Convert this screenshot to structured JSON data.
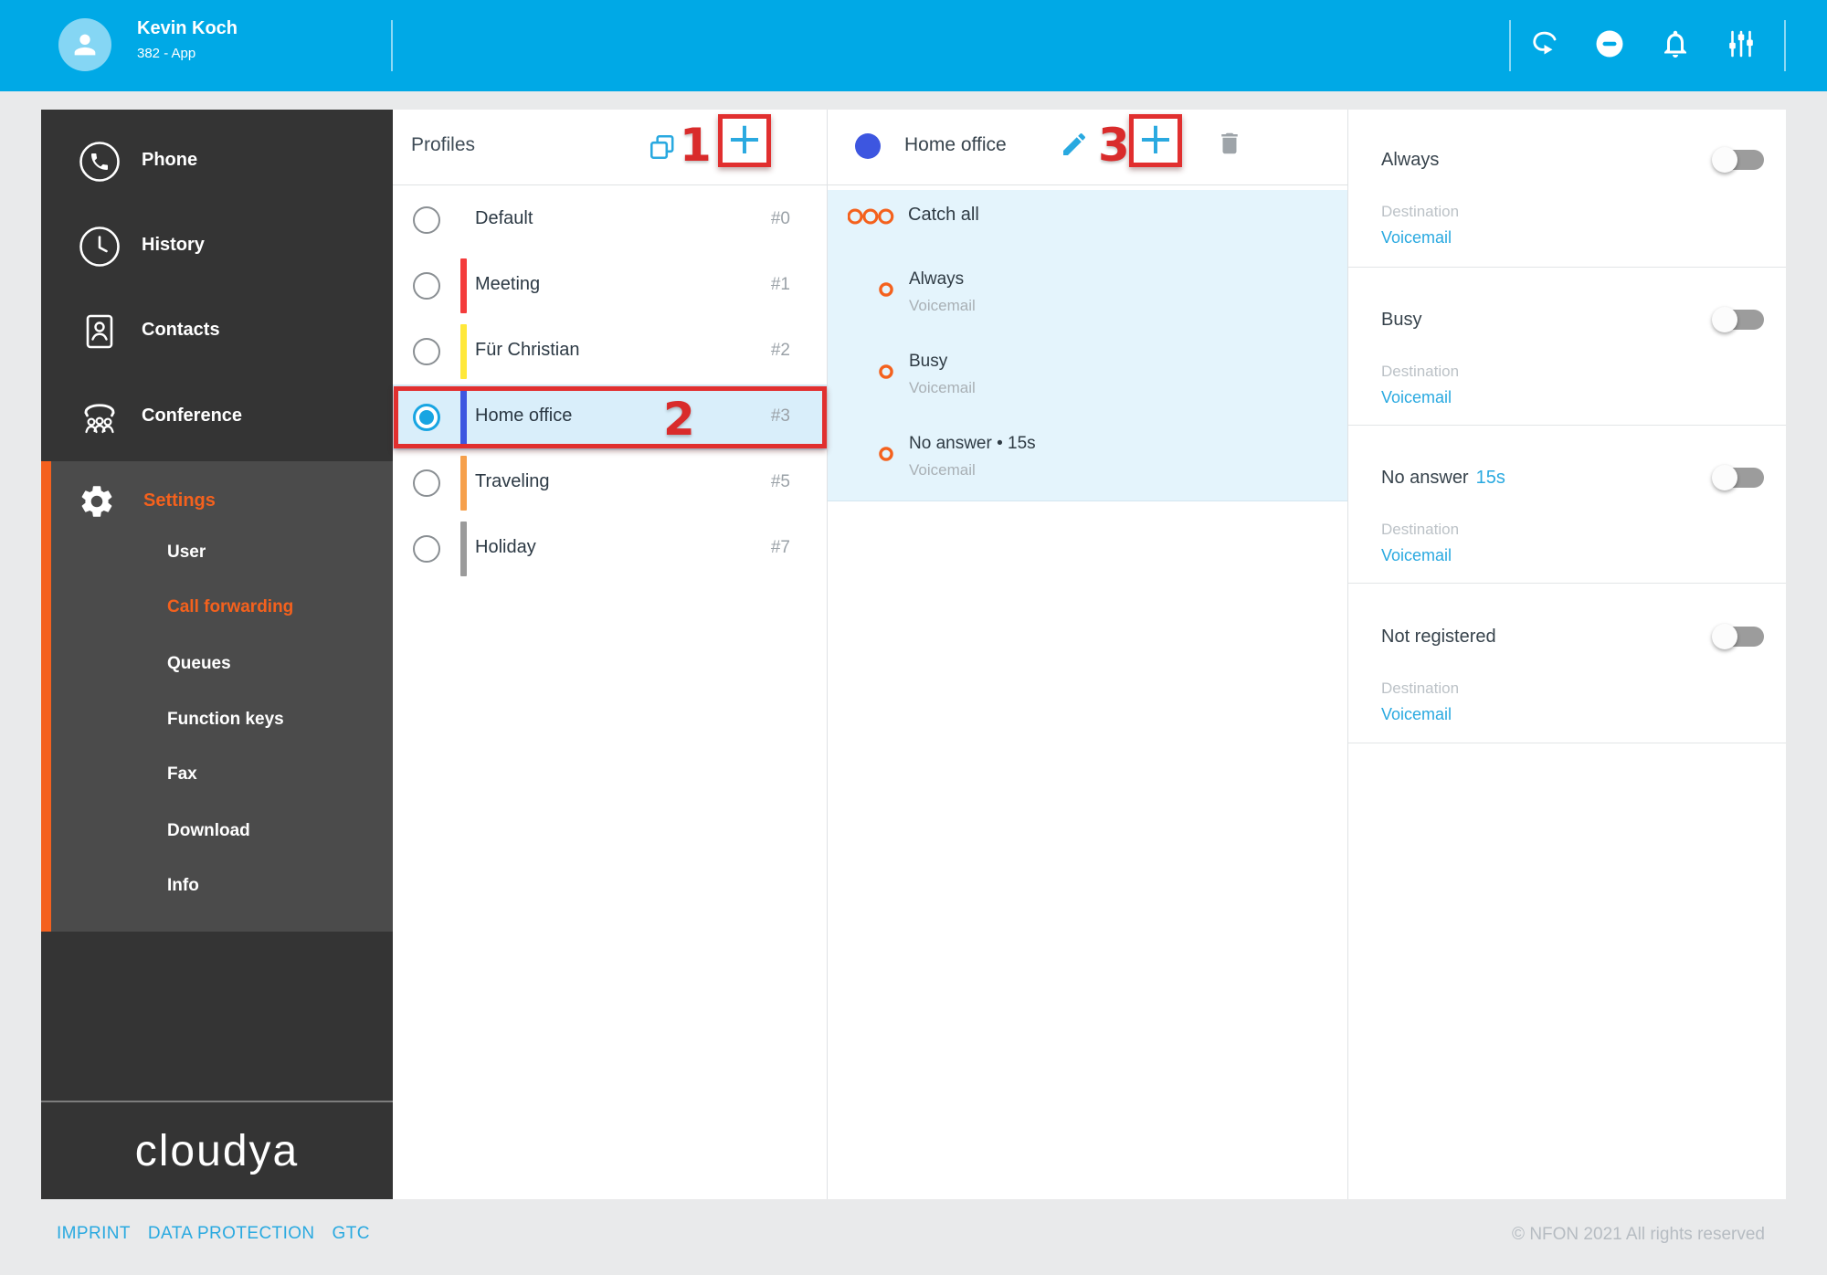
{
  "topbar": {
    "user": {
      "name": "Kevin Koch",
      "subtitle": "382 - App"
    }
  },
  "sidebar": {
    "nav": [
      {
        "label": "Phone"
      },
      {
        "label": "History"
      },
      {
        "label": "Contacts"
      },
      {
        "label": "Conference"
      }
    ],
    "settings_label": "Settings",
    "settings_items": [
      {
        "label": "User",
        "active": false
      },
      {
        "label": "Call forwarding",
        "active": true
      },
      {
        "label": "Queues",
        "active": false
      },
      {
        "label": "Function keys",
        "active": false
      },
      {
        "label": "Fax",
        "active": false
      },
      {
        "label": "Download",
        "active": false
      },
      {
        "label": "Info",
        "active": false
      }
    ],
    "logo": "cloudya"
  },
  "profiles": {
    "title": "Profiles",
    "items": [
      {
        "label": "Default",
        "number": "#0",
        "color": "",
        "selected": false
      },
      {
        "label": "Meeting",
        "number": "#1",
        "color": "#f43b3b",
        "selected": false
      },
      {
        "label": "Für Christian",
        "number": "#2",
        "color": "#ffe83a",
        "selected": false
      },
      {
        "label": "Home office",
        "number": "#3",
        "color": "#3d56e0",
        "selected": true
      },
      {
        "label": "Traveling",
        "number": "#5",
        "color": "#f6a04c",
        "selected": false
      },
      {
        "label": "Holiday",
        "number": "#7",
        "color": "#9b9b9b",
        "selected": false
      }
    ]
  },
  "detail": {
    "title": "Home office",
    "dot_color": "#3d56e0",
    "catch_all": "Catch all",
    "rules": [
      {
        "label": "Always",
        "destination": "Voicemail"
      },
      {
        "label": "Busy",
        "destination": "Voicemail"
      },
      {
        "label": "No answer • 15s",
        "destination": "Voicemail"
      }
    ]
  },
  "forwarding": {
    "destination_label": "Destination",
    "sections": [
      {
        "title": "Always",
        "time": "",
        "destination": "Voicemail",
        "enabled": false
      },
      {
        "title": "Busy",
        "time": "",
        "destination": "Voicemail",
        "enabled": false
      },
      {
        "title": "No answer",
        "time": "15s",
        "destination": "Voicemail",
        "enabled": false
      },
      {
        "title": "Not registered",
        "time": "",
        "destination": "Voicemail",
        "enabled": false
      }
    ]
  },
  "annotations": {
    "step1": "1",
    "step2": "2",
    "step3": "3"
  },
  "footer": {
    "links": [
      {
        "label": "IMPRINT"
      },
      {
        "label": "DATA PROTECTION"
      },
      {
        "label": "GTC"
      }
    ],
    "copyright": "© NFON 2021 All rights reserved"
  },
  "icons": {
    "topbar": [
      "forward-icon",
      "do-not-disturb-icon",
      "bell-icon",
      "sliders-icon"
    ],
    "sidebar": [
      "phone-icon",
      "clock-icon",
      "contacts-icon",
      "conference-icon",
      "gear-icon"
    ],
    "panel": [
      "copy-icon",
      "plus-icon",
      "pencil-icon",
      "trash-icon",
      "catch-all-icon"
    ]
  },
  "colors": {
    "topbar": "#00a9e6",
    "accent_cyan": "#29a9e0",
    "accent_orange": "#f4611d",
    "annotation_red": "#e12f2f",
    "profile_blue": "#3d56e0"
  }
}
